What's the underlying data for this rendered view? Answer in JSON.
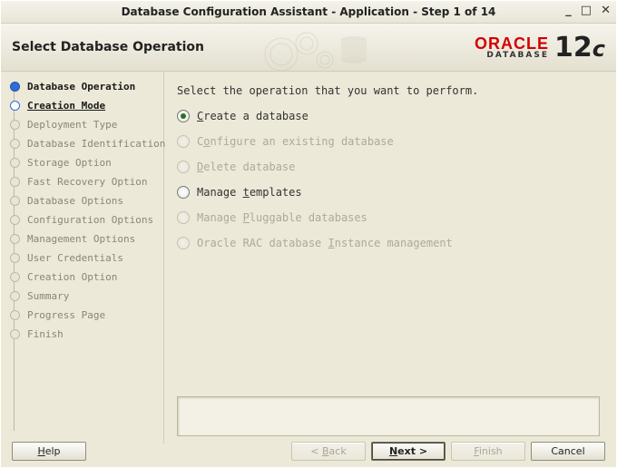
{
  "window": {
    "title": "Database Configuration Assistant - Application - Step 1 of 14"
  },
  "banner": {
    "title": "Select Database Operation",
    "brand_word": "ORACLE",
    "brand_sub": "DATABASE",
    "version": "12",
    "version_suffix": "c"
  },
  "sidebar": {
    "steps": [
      {
        "label": "Database Operation",
        "state": "current"
      },
      {
        "label": "Creation Mode",
        "state": "pendingactive"
      },
      {
        "label": "Deployment Type",
        "state": "disabled"
      },
      {
        "label": "Database Identification",
        "state": "disabled"
      },
      {
        "label": "Storage Option",
        "state": "disabled"
      },
      {
        "label": "Fast Recovery Option",
        "state": "disabled"
      },
      {
        "label": "Database Options",
        "state": "disabled"
      },
      {
        "label": "Configuration Options",
        "state": "disabled"
      },
      {
        "label": "Management Options",
        "state": "disabled"
      },
      {
        "label": "User Credentials",
        "state": "disabled"
      },
      {
        "label": "Creation Option",
        "state": "disabled"
      },
      {
        "label": "Summary",
        "state": "disabled"
      },
      {
        "label": "Progress Page",
        "state": "disabled"
      },
      {
        "label": "Finish",
        "state": "disabled"
      }
    ]
  },
  "main": {
    "instruction": "Select the operation that you want to perform.",
    "options": [
      {
        "pre": "",
        "accel": "C",
        "post": "reate a database",
        "enabled": true,
        "selected": true
      },
      {
        "pre": "C",
        "accel": "o",
        "post": "nfigure an existing database",
        "enabled": false,
        "selected": false
      },
      {
        "pre": "",
        "accel": "D",
        "post": "elete database",
        "enabled": false,
        "selected": false
      },
      {
        "pre": "Manage ",
        "accel": "t",
        "post": "emplates",
        "enabled": true,
        "selected": false
      },
      {
        "pre": "Manage ",
        "accel": "P",
        "post": "luggable databases",
        "enabled": false,
        "selected": false
      },
      {
        "pre": "Oracle RAC database ",
        "accel": "I",
        "post": "nstance management",
        "enabled": false,
        "selected": false
      }
    ]
  },
  "buttons": {
    "help_pre": "",
    "help_accel": "H",
    "help_post": "elp",
    "back_pre": "< ",
    "back_accel": "B",
    "back_post": "ack",
    "next_pre": "",
    "next_accel": "N",
    "next_post": "ext >",
    "finish_pre": "",
    "finish_accel": "F",
    "finish_post": "inish",
    "cancel": "Cancel"
  }
}
